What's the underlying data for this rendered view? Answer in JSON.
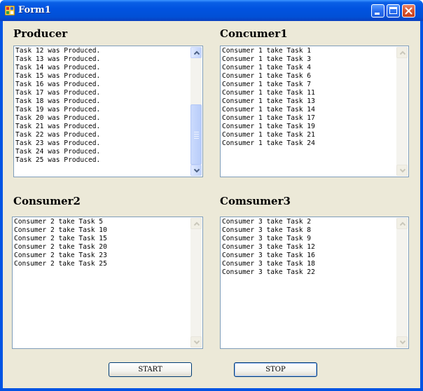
{
  "window": {
    "title": "Form1"
  },
  "producer": {
    "label": "Producer",
    "items": [
      "Task 12 was Produced.",
      "Task 13 was Produced.",
      "Task 14 was Produced.",
      "Task 15 was Produced.",
      "Task 16 was Produced.",
      "Task 17 was Produced.",
      "Task 18 was Produced.",
      "Task 19 was Produced.",
      "Task 20 was Produced.",
      "Task 21 was Produced.",
      "Task 22 was Produced.",
      "Task 23 was Produced.",
      "Task 24 was Produced.",
      "Task 25 was Produced."
    ]
  },
  "consumer1": {
    "label": "Concumer1",
    "items": [
      "Consumer 1 take Task 1",
      "Consumer 1 take Task 3",
      "Consumer 1 take Task 4",
      "Consumer 1 take Task 6",
      "Consumer 1 take Task 7",
      "Consumer 1 take Task 11",
      "Consumer 1 take Task 13",
      "Consumer 1 take Task 14",
      "Consumer 1 take Task 17",
      "Consumer 1 take Task 19",
      "Consumer 1 take Task 21",
      "Consumer 1 take Task 24"
    ]
  },
  "consumer2": {
    "label": "Consumer2",
    "items": [
      "Consumer 2 take Task 5",
      "Consumer 2 take Task 10",
      "Consumer 2 take Task 15",
      "Consumer 2 take Task 20",
      "Consumer 2 take Task 23",
      "Consumer 2 take Task 25"
    ]
  },
  "consumer3": {
    "label": "Comsumer3",
    "items": [
      "Consumer 3 take Task 2",
      "Consumer 3 take Task 8",
      "Consumer 3 take Task 9",
      "Consumer 3 take Task 12",
      "Consumer 3 take Task 16",
      "Consumer 3 take Task 18",
      "Consumer 3 take Task 22"
    ]
  },
  "buttons": {
    "start_label": "START",
    "stop_label": "STOP"
  },
  "icons": {
    "app": "form-icon",
    "minimize": "minimize-icon",
    "maximize": "maximize-icon",
    "close": "close-icon",
    "scroll_up": "chevron-up-icon",
    "scroll_down": "chevron-down-icon"
  },
  "colors": {
    "titlebar": "#0153e0",
    "client": "#ece9d8",
    "list_border": "#7f9db9",
    "button_border": "#003c74"
  }
}
